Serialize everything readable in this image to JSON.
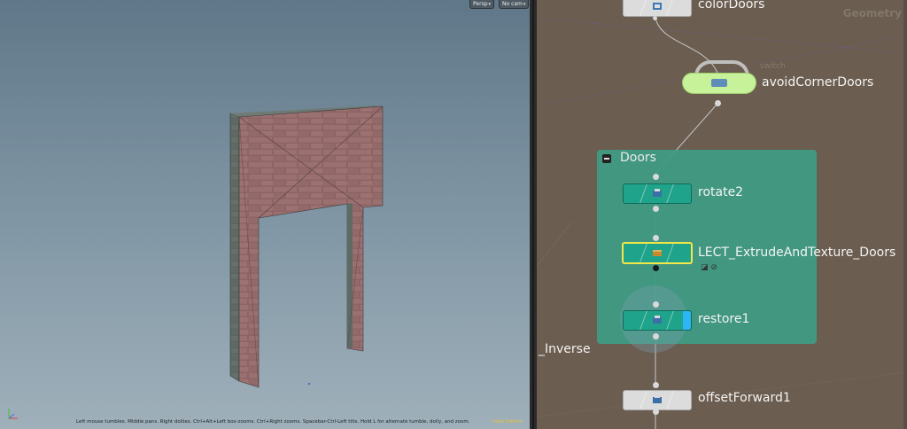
{
  "viewport": {
    "persp_menu": "Persp",
    "cam_menu": "No cam",
    "status_hint": "Left mouse tumbles. Middle pans. Right dollies. Ctrl+Alt+Left box-zooms. Ctrl+Right zooms. Spacebar-Ctrl-Left tilts. Hold L for alternate tumble, dolly, and zoom.",
    "status_right": "Indie Edition",
    "axis_icon": "axis-gizmo-icon"
  },
  "network": {
    "context_label": "Geometry",
    "nodes": {
      "colorDoors": "colorDoors",
      "avoidCornerDoors": "avoidCornerDoors",
      "rotate2": "rotate2",
      "lect": "LECT_ExtrudeAndTexture_Doors",
      "restore1": "restore1",
      "offsetForward1": "offsetForward1"
    },
    "network_box_title": "Doors",
    "inverse_label": "_Inverse"
  },
  "colors": {
    "network_bg": "#6b5d4f",
    "node_green": "#1fa38a",
    "switch_green": "#c8f29a",
    "netbox": "#3e9c84",
    "selected": "#f1e74a",
    "display_flag": "#2db6f4"
  }
}
